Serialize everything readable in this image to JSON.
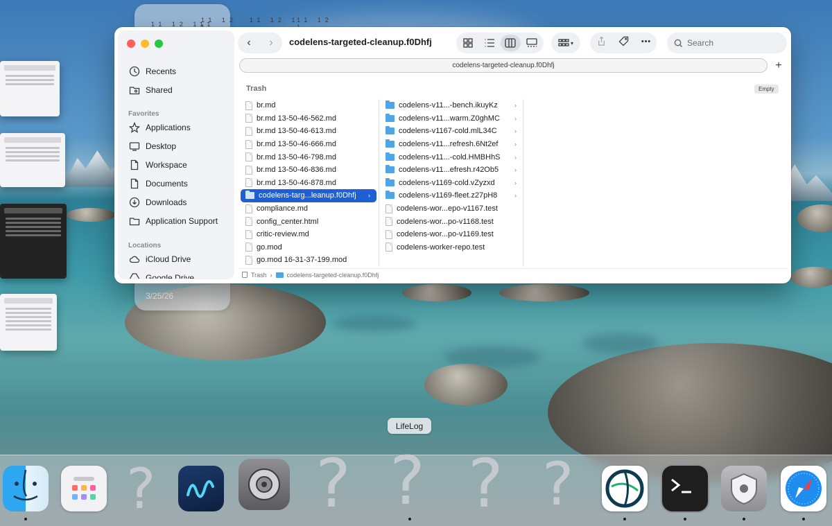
{
  "widget": {
    "clock_label": "11 12 1",
    "date": "3/25/26"
  },
  "window": {
    "title": "codelens-targeted-cleanup.f0Dhfj",
    "tab_label": "codelens-targeted-cleanup.f0Dhfj",
    "add_tab": "+",
    "search_placeholder": "Search",
    "nav_back": "‹",
    "nav_forward": "›"
  },
  "sidebar": {
    "favorites_header": "Favorites",
    "locations_header": "Locations",
    "items": [
      {
        "label": "Recents",
        "icon": "clock-icon"
      },
      {
        "label": "Shared",
        "icon": "shared-folder-icon"
      },
      {
        "label": "Applications",
        "icon": "applications-icon"
      },
      {
        "label": "Desktop",
        "icon": "desktop-icon"
      },
      {
        "label": "Workspace",
        "icon": "document-icon"
      },
      {
        "label": "Documents",
        "icon": "document-icon"
      },
      {
        "label": "Downloads",
        "icon": "download-icon"
      },
      {
        "label": "Application Support",
        "icon": "folder-icon"
      },
      {
        "label": "iCloud Drive",
        "icon": "cloud-icon"
      },
      {
        "label": "Google Drive",
        "icon": "drive-icon"
      }
    ]
  },
  "browser": {
    "section_header": "Trash",
    "empty_button": "Empty",
    "column1": [
      "br.md",
      "br.md 13-50-46-562.md",
      "br.md 13-50-46-613.md",
      "br.md 13-50-46-666.md",
      "br.md 13-50-46-798.md",
      "br.md 13-50-46-836.md",
      "br.md 13-50-46-878.md",
      "codelens-targ...leanup.f0Dhfj",
      "compliance.md",
      "config_center.html",
      "critic-review.md",
      "go.mod",
      "go.mod 16-31-37-199.mod"
    ],
    "column2": [
      "codelens-v11...-bench.ikuyKz",
      "codelens-v11...warm.Z0ghMC",
      "codelens-v1167-cold.mlL34C",
      "codelens-v11...refresh.6Nt2ef",
      "codelens-v11...-cold.HMBHhS",
      "codelens-v11...efresh.r42Ob5",
      "codelens-v1169-cold.vZyzxd",
      "codelens-v1169-fleet.z27pH8",
      "codelens-wor...epo-v1167.test",
      "codelens-wor...po-v1168.test",
      "codelens-wor...po-v1169.test",
      "codelens-worker-repo.test"
    ],
    "row_chevron": "›"
  },
  "pathbar": {
    "root": "Trash",
    "separator": "›",
    "current": "codelens-targeted-cleanup.f0Dhfj"
  },
  "dock": {
    "tooltip": "LifeLog",
    "placeholder_glyph": "?"
  },
  "colors": {
    "selection": "#1f5fd6",
    "folder": "#4ea6e6"
  }
}
